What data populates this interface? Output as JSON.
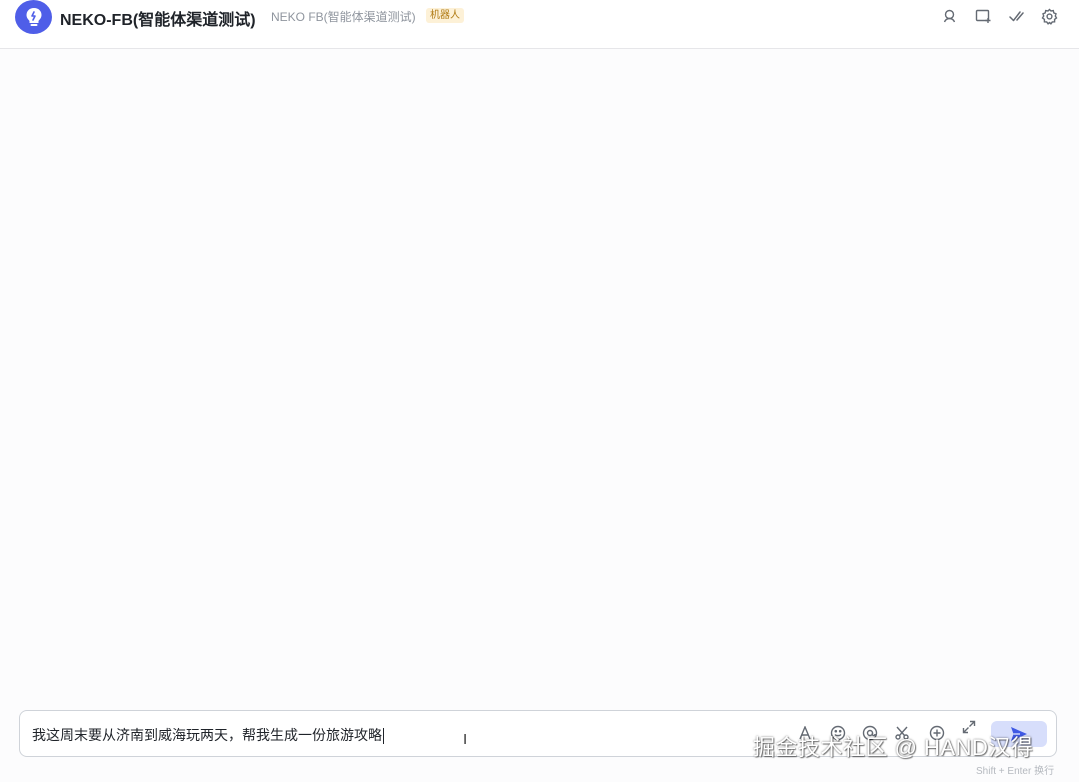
{
  "header": {
    "title": "NEKO-FB(智能体渠道测试)",
    "subtitle": "NEKO FB(智能体渠道测试)",
    "badge": "机器人",
    "icons": [
      "search-user-icon",
      "add-chat-icon",
      "check-edit-icon",
      "settings-icon"
    ]
  },
  "composer": {
    "text": "我这周末要从济南到威海玩两天，帮我生成一份旅游攻略",
    "hint": "Shift + Enter 换行",
    "tools": [
      "font-icon",
      "emoji-icon",
      "mention-icon",
      "scissors-icon",
      "add-icon",
      "expand-icon"
    ]
  },
  "watermark": "掘金技术社区 @ HAND汉得",
  "colors": {
    "accent": "#4f5ee8",
    "send_bg": "#d7defb",
    "badge_bg": "#fdf1d7"
  }
}
